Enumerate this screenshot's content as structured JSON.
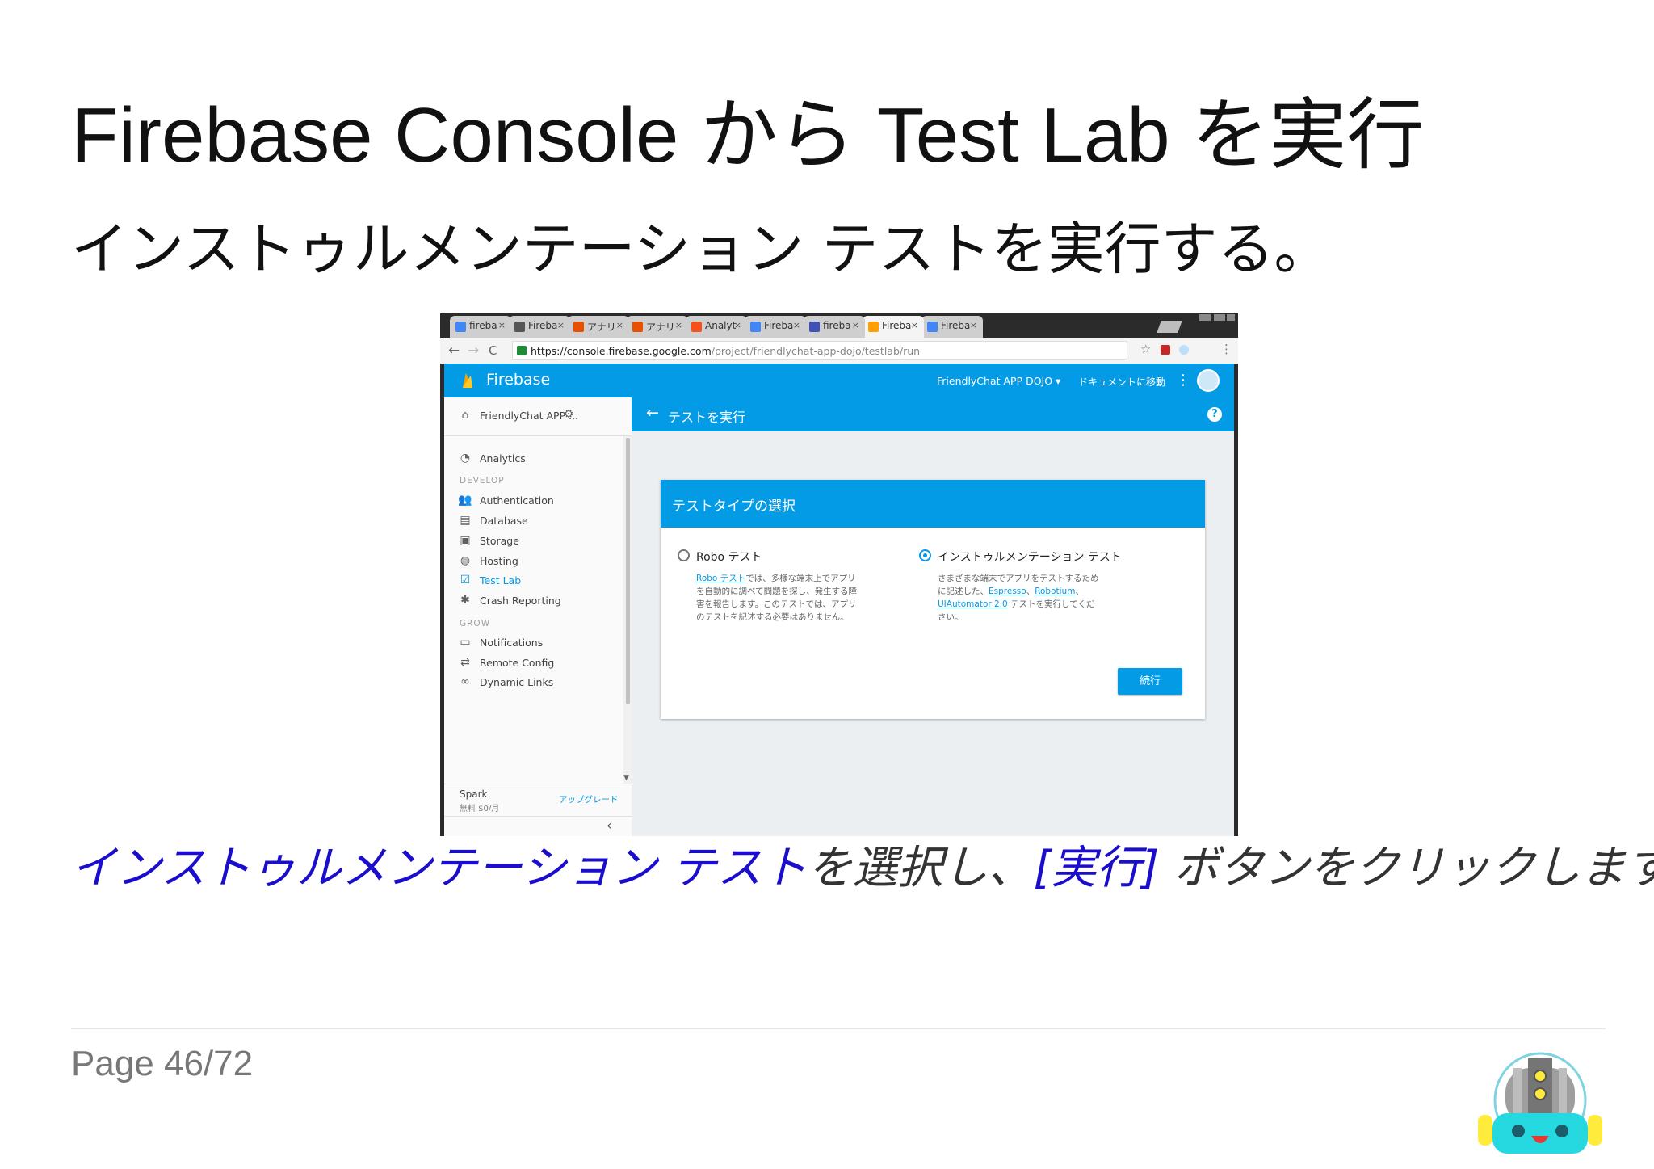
{
  "slide": {
    "title": "Firebase Console から Test Lab を実行",
    "subtitle": "インストゥルメンテーション テストを実行する。",
    "caption": {
      "link1": "インストゥルメンテーション テスト",
      "text1": "を選択し、",
      "link2": "[実行]",
      "text2": " ボタンをクリックします。"
    },
    "page": "Page 46/72"
  },
  "browser": {
    "tabs": [
      {
        "label": "fireba",
        "favicon_color": "#4285f4"
      },
      {
        "label": "Fireba",
        "favicon_color": "#555555"
      },
      {
        "label": "アナリ",
        "favicon_color": "#e65100"
      },
      {
        "label": "アナリ",
        "favicon_color": "#e65100"
      },
      {
        "label": "Analyt",
        "favicon_color": "#f4511e"
      },
      {
        "label": "Fireba",
        "favicon_color": "#4285f4"
      },
      {
        "label": "fireba",
        "favicon_color": "#3f51b5"
      },
      {
        "label": "Fireba",
        "favicon_color": "#ffa000",
        "active": true
      },
      {
        "label": "Fireba",
        "favicon_color": "#4285f4"
      }
    ],
    "tab_close": "×",
    "url_host": "https://console.firebase.google.com",
    "url_path": "/project/friendlychat-app-dojo/testlab/run",
    "icons": {
      "back": "←",
      "forward": "→",
      "reload": "C",
      "star": "☆",
      "menu": "⋮"
    }
  },
  "firebase": {
    "brand": "Firebase",
    "project_selector": "FriendlyChat APP DOJO ▾",
    "docs_link": "ドキュメントに移動",
    "sidebar": {
      "project": "FriendlyChat APP ...",
      "analytics": "Analytics",
      "section_develop": "DEVELOP",
      "develop_items": [
        "Authentication",
        "Database",
        "Storage",
        "Hosting",
        "Test Lab",
        "Crash Reporting"
      ],
      "section_grow": "GROW",
      "grow_items": [
        "Notifications",
        "Remote Config",
        "Dynamic Links"
      ],
      "plan_name": "Spark",
      "plan_price": "無料 $0/月",
      "upgrade": "アップグレード",
      "collapse": "‹"
    },
    "main": {
      "title": "テストを実行",
      "help": "?",
      "card_title": "テストタイプの選択",
      "option_robo": {
        "label": "Robo テスト",
        "link": "Robo テスト",
        "desc": "では、多様な端末上でアプリを自動的に調べて問題を探し、発生する障害を報告します。このテストでは、アプリのテストを記述する必要はありません。",
        "selected": false
      },
      "option_instr": {
        "label": "インストゥルメンテーション テスト",
        "desc1": "さまざまな端末でアプリをテストするために記述した、",
        "link1": "Espresso",
        "sep1": "、",
        "link2": "Robotium",
        "sep2": "、",
        "link3": "UIAutomator 2.0",
        "desc2": " テストを実行してください。",
        "selected": true
      },
      "continue_button": "続行"
    }
  },
  "colors": {
    "firebase_blue": "#039be5",
    "caption_link": "#1a0dcc"
  }
}
